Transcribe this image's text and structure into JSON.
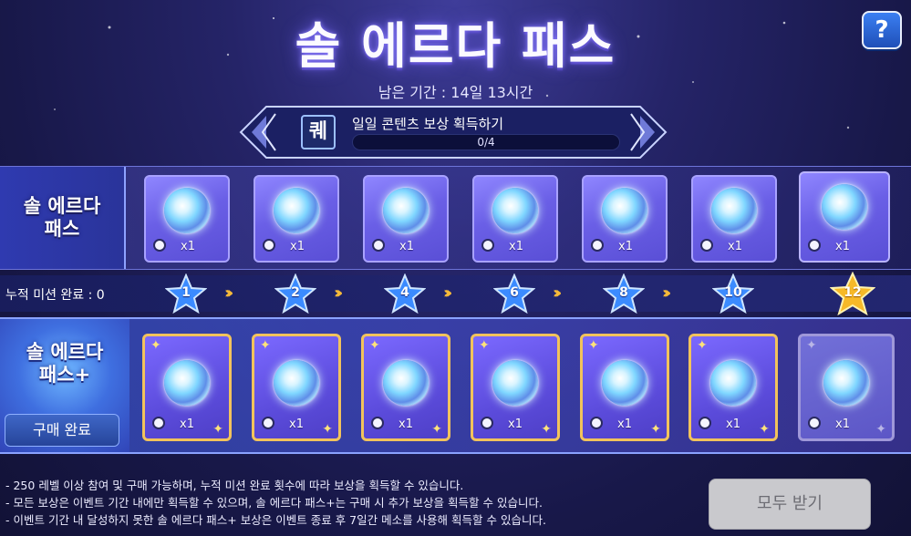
{
  "header": {
    "title": "솔 에르다 패스",
    "period": "남은 기간 : 14일 13시간",
    "help_label": "?"
  },
  "mission": {
    "icon_label": "퀘",
    "label": "일일 콘텐츠 보상 획득하기",
    "progress_text": "0/4"
  },
  "free_row": {
    "label_line1": "솔 에르다",
    "label_line2": "패스",
    "rewards": [
      {
        "qty": "x1"
      },
      {
        "qty": "x1"
      },
      {
        "qty": "x1"
      },
      {
        "qty": "x1"
      },
      {
        "qty": "x1"
      },
      {
        "qty": "x1"
      },
      {
        "qty": "x1"
      }
    ]
  },
  "track": {
    "label": "누적 미션 완료 : 0",
    "milestones": [
      "1",
      "2",
      "4",
      "6",
      "8",
      "10",
      "12"
    ]
  },
  "plus_row": {
    "label_line1": "솔 에르다",
    "label_line2": "패스+",
    "buy_label": "구매 완료",
    "rewards": [
      {
        "qty": "x1"
      },
      {
        "qty": "x1"
      },
      {
        "qty": "x1"
      },
      {
        "qty": "x1"
      },
      {
        "qty": "x1"
      },
      {
        "qty": "x1"
      },
      {
        "qty": "x1"
      }
    ]
  },
  "notes": [
    "- 250 레벨 이상 참여 및 구매 가능하며, 누적 미션 완료 횟수에 따라 보상을 획득할 수 있습니다.",
    "- 모든 보상은 이벤트 기간 내에만 획득할 수 있으며, 솔 에르다 패스+는 구매 시 추가 보상을 획득할 수 있습니다.",
    "- 이벤트 기간 내 달성하지 못한 솔 에르다 패스+ 보상은 이벤트 종료 후 7일간 메소를 사용해 획득할 수 있습니다."
  ],
  "claim_all_label": "모두 받기",
  "colors": {
    "accent_gold": "#f2c35c",
    "star_blue": "#4aa0ff",
    "disabled_button": "#c9c9cd"
  }
}
